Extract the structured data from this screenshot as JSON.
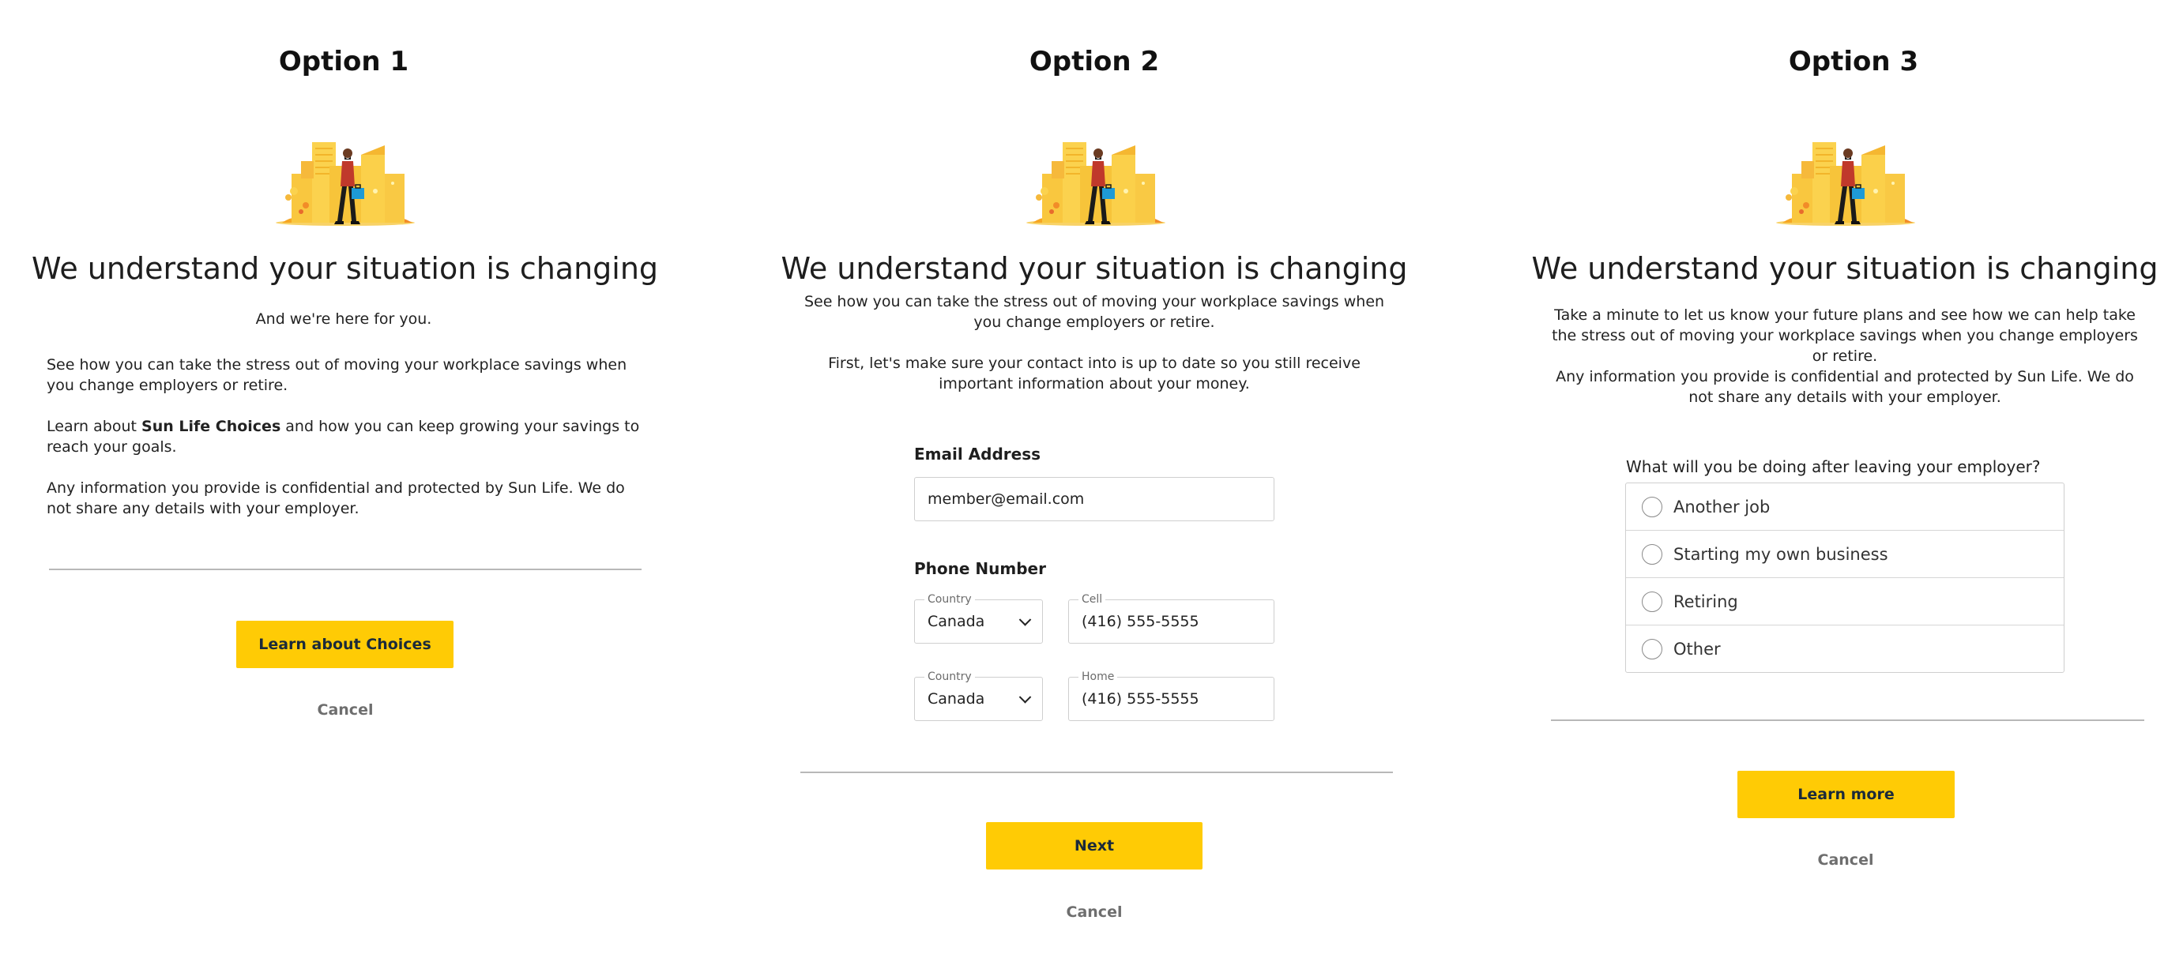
{
  "illustration": {
    "name": "person-walking-city-illustration"
  },
  "colors": {
    "accent": "#ffcb05",
    "button_text": "#1b2a3a",
    "cancel_text": "#6e6e6e",
    "divider": "#b8b8b8"
  },
  "option1": {
    "title": "Option 1",
    "headline": "We understand your situation is changing",
    "subheadline": "And we're here for you.",
    "para1": "See how you can take the stress out of moving your workplace savings when you change employers or retire.",
    "para2_prefix": "Learn about ",
    "para2_bold": "Sun Life Choices",
    "para2_suffix": " and how you can keep growing your savings to reach your goals.",
    "para3": "Any information you provide is confidential and protected by Sun Life. We do not share any details with your employer.",
    "primary_button": "Learn about Choices",
    "cancel": "Cancel"
  },
  "option2": {
    "title": "Option 2",
    "headline": "We understand your situation is changing",
    "para1": "See how you can take the stress out of moving your workplace savings when you change employers or retire.",
    "para2": "First, let's make sure your contact into is up to date so you still receive important information about your money.",
    "email_label": "Email Address",
    "email_value": "member@email.com",
    "phone_label": "Phone Number",
    "phones": [
      {
        "country_label": "Country",
        "country_value": "Canada",
        "number_label": "Cell",
        "number_value": "(416) 555-5555"
      },
      {
        "country_label": "Country",
        "country_value": "Canada",
        "number_label": "Home",
        "number_value": "(416) 555-5555"
      }
    ],
    "primary_button": "Next",
    "cancel": "Cancel"
  },
  "option3": {
    "title": "Option 3",
    "headline": "We understand your situation is changing",
    "para1": "Take a minute to let us know your future plans and see how we can help take the stress out of moving your workplace savings when you change employers or retire.",
    "para2": "Any information you provide is confidential and protected by Sun Life. We do not share any details with your employer.",
    "question": "What will you be doing after leaving your employer?",
    "options": [
      "Another job",
      "Starting my own business",
      "Retiring",
      "Other"
    ],
    "primary_button": "Learn more",
    "cancel": "Cancel"
  }
}
